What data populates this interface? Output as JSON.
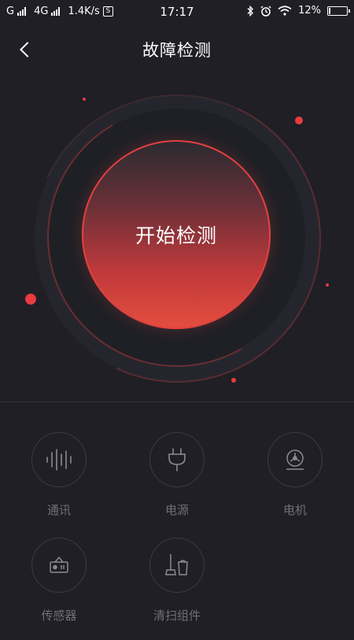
{
  "status_bar": {
    "carrier": "G",
    "network": "4G",
    "speed": "1.4K/s",
    "s_badge": "S",
    "time": "17:17",
    "battery_text": "12%",
    "battery_level": 0.12
  },
  "header": {
    "title": "故障检测",
    "back_icon": "back-chevron-icon"
  },
  "hero": {
    "start_label": "开始检测",
    "accent_color": "#e44e3e"
  },
  "modules": [
    {
      "label": "通讯",
      "icon": "waveform-icon"
    },
    {
      "label": "电源",
      "icon": "plug-icon"
    },
    {
      "label": "电机",
      "icon": "motor-icon"
    },
    {
      "label": "传感器",
      "icon": "sensor-icon"
    },
    {
      "label": "清扫组件",
      "icon": "cleaning-kit-icon"
    }
  ]
}
